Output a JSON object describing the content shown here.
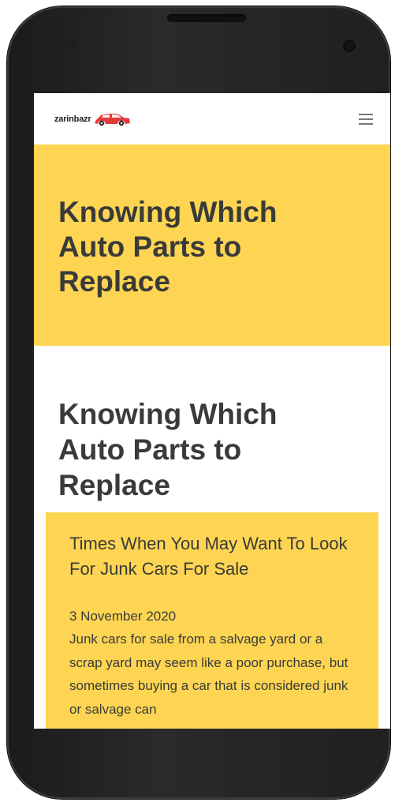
{
  "device": {
    "frame_color": "#1f1f1f",
    "icons": {
      "speaker": "speaker-grille",
      "camera": "front-camera",
      "sensor": "proximity-sensor"
    }
  },
  "header": {
    "logo_text": "zarinbazr",
    "logo_icon": "red-car-icon",
    "menu_icon": "hamburger-menu-icon",
    "brand_color": "#e23b3b"
  },
  "hero": {
    "title": "Knowing Which Auto Parts to Replace",
    "background": "#fed552"
  },
  "main": {
    "section_title": "Knowing Which Auto Parts to Replace",
    "post": {
      "title": "Times When You May Want To Look For Junk Cars For Sale",
      "date": "3 November 2020",
      "excerpt": "Junk cars for sale from a salvage yard or a scrap yard may seem like a poor purchase, but sometimes buying a car that is considered junk or salvage can"
    }
  }
}
